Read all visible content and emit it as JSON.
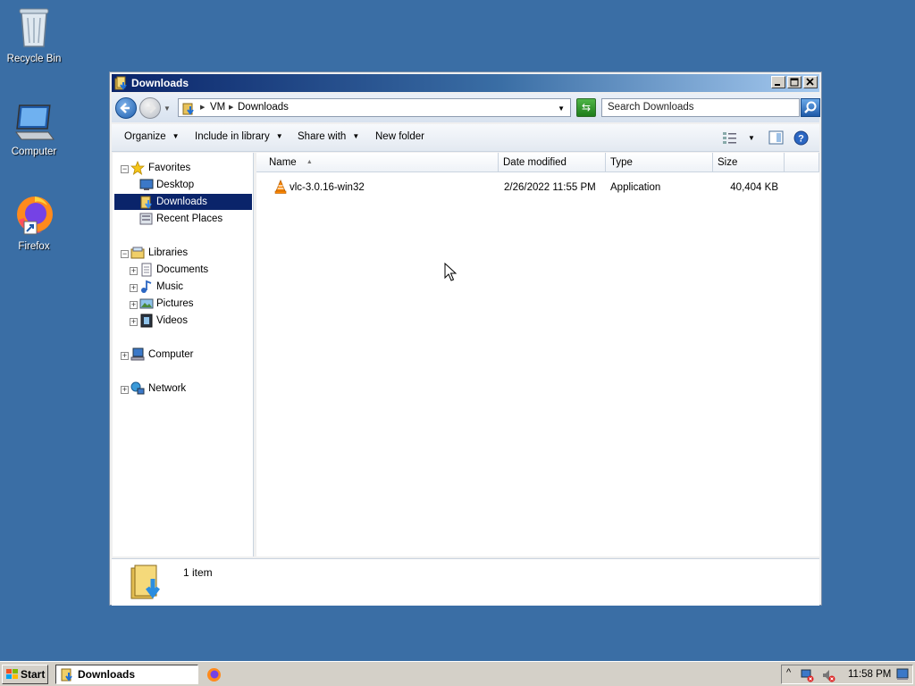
{
  "desktop": {
    "icons": [
      {
        "label": "Recycle Bin"
      },
      {
        "label": "Computer"
      },
      {
        "label": "Firefox"
      }
    ]
  },
  "window": {
    "title": "Downloads",
    "address": {
      "crumbs": [
        "VM",
        "Downloads"
      ]
    },
    "search_placeholder": "Search Downloads",
    "toolbar": {
      "organize": "Organize",
      "include": "Include in library",
      "share": "Share with",
      "new_folder": "New folder"
    },
    "nav": {
      "favorites": "Favorites",
      "desktop": "Desktop",
      "downloads": "Downloads",
      "recent": "Recent Places",
      "libraries": "Libraries",
      "documents": "Documents",
      "music": "Music",
      "pictures": "Pictures",
      "videos": "Videos",
      "computer": "Computer",
      "network": "Network"
    },
    "columns": [
      "Name",
      "Date modified",
      "Type",
      "Size"
    ],
    "files": [
      {
        "name": "vlc-3.0.16-win32",
        "date": "2/26/2022 11:55 PM",
        "type": "Application",
        "size": "40,404 KB"
      }
    ],
    "status": "1 item"
  },
  "taskbar": {
    "start": "Start",
    "task": "Downloads",
    "clock": "11:58 PM"
  },
  "colors": {
    "desktop": "#3a6ea5",
    "selection": "#0a246a",
    "titlebar": "#0a246a"
  }
}
